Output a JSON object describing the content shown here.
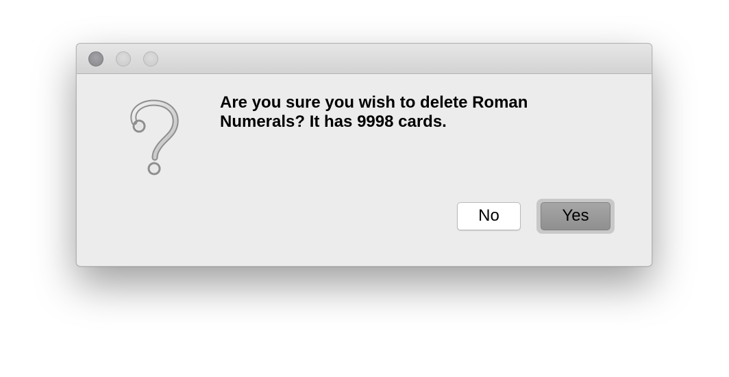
{
  "dialog": {
    "message_line1": "Are you sure you wish to delete Roman",
    "message_line2": "Numerals? It has 9998 cards.",
    "icon": "question-mark-icon",
    "buttons": {
      "no_label": "No",
      "yes_label": "Yes"
    }
  },
  "window_controls": {
    "close_icon": "close-icon",
    "minimize_icon": "minimize-icon",
    "zoom_icon": "zoom-icon"
  },
  "colors": {
    "window_bg": "#ececec",
    "default_button": "#999999",
    "text": "#000000"
  }
}
